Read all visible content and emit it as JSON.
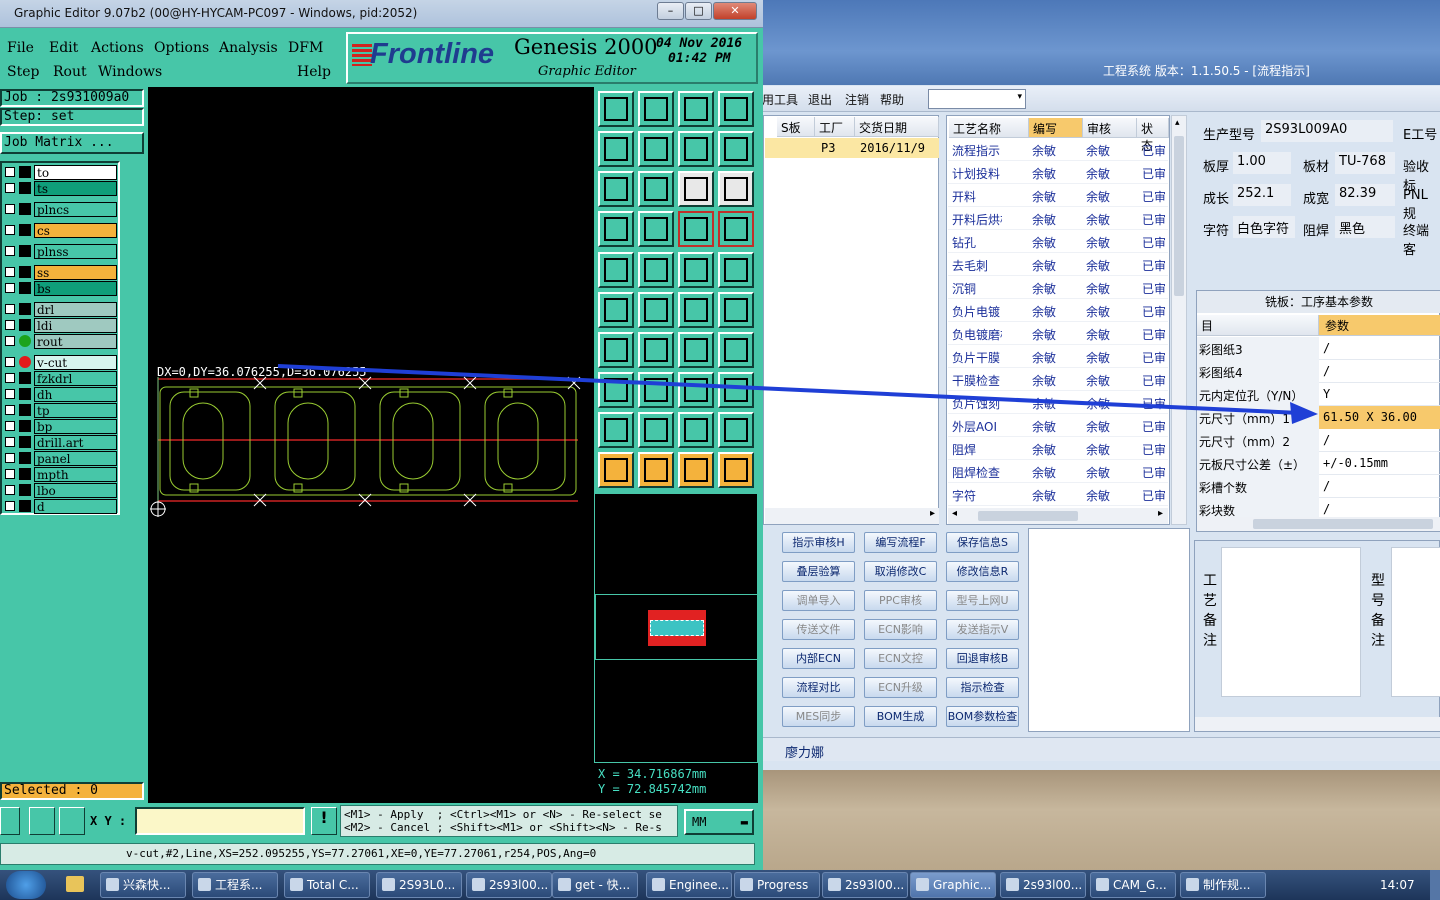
{
  "genesis": {
    "title": "Graphic Editor 9.07b2 (00@HY-HYCAM-PC097 - Windows, pid:2052)",
    "menu_row1": [
      "File",
      "Edit",
      "Actions",
      "Options",
      "Analysis",
      "DFM"
    ],
    "menu_row2": [
      "Step",
      "Rout",
      "Windows",
      "Help"
    ],
    "brand": "Frontline",
    "product": "Genesis 2000",
    "subtitle": "Graphic Editor",
    "date": "04 Nov 2016",
    "time": "01:42 PM",
    "job": "Job : 2s931009a0",
    "step": "Step: set",
    "job_matrix": "Job Matrix ...",
    "layers": [
      {
        "name": "to",
        "color": "#ffffff",
        "mark": "box"
      },
      {
        "name": "ts",
        "color": "#0f9e7a",
        "mark": "box"
      },
      {
        "name": "plncs",
        "color": "#47c6a8",
        "mark": "box"
      },
      {
        "name": "cs",
        "color": "#f4b23c",
        "mark": "box"
      },
      {
        "name": "plnss",
        "color": "#47c6a8",
        "mark": "box"
      },
      {
        "name": "ss",
        "color": "#f4b23c",
        "mark": "box"
      },
      {
        "name": "bs",
        "color": "#0f9e7a",
        "mark": "box"
      },
      {
        "name": "drl",
        "color": "#9fc9c0",
        "mark": "box"
      },
      {
        "name": "ldi",
        "color": "#9fc9c0",
        "mark": "box"
      },
      {
        "name": "rout",
        "color": "#9fc9c0",
        "mark": "green"
      },
      {
        "name": "v-cut",
        "color": "#d7f5ee",
        "mark": "red"
      },
      {
        "name": "fzkdrl",
        "color": "#47c6a8",
        "mark": "box"
      },
      {
        "name": "dh",
        "color": "#47c6a8",
        "mark": "box"
      },
      {
        "name": "tp",
        "color": "#47c6a8",
        "mark": "box"
      },
      {
        "name": "bp",
        "color": "#47c6a8",
        "mark": "box"
      },
      {
        "name": "drill.art",
        "color": "#47c6a8",
        "mark": "box"
      },
      {
        "name": "panel",
        "color": "#47c6a8",
        "mark": "box"
      },
      {
        "name": "mpth",
        "color": "#47c6a8",
        "mark": "box"
      },
      {
        "name": "lbo",
        "color": "#47c6a8",
        "mark": "box"
      },
      {
        "name": "d",
        "color": "#47c6a8",
        "mark": "box"
      }
    ],
    "selected": "Selected : 0",
    "measure": "DX=0,DY=36.076255,D=36.076255",
    "coord_x": "X = 34.716867mm",
    "coord_y": "Y = 72.845742mm",
    "xy_label": "X Y :",
    "hint1": "<M1> - Apply  ; <Ctrl><M1> or <N> - Re-select se",
    "hint2": "<M2> - Cancel ; <Shift><M1> or <Shift><N> - Re-s",
    "units": "MM",
    "status": "v-cut,#2,Line,XS=252.095255,YS=77.27061,XE=0,YE=77.27061,r254,POS,Ang=0"
  },
  "erp": {
    "title": "工程系统  版本：1.1.50.5 - [流程指示]",
    "menu": [
      "用工具",
      "退出",
      "注销",
      "帮助"
    ],
    "orders_headers": [
      "S板",
      "工厂",
      "交货日期"
    ],
    "orders_row": [
      "P3",
      "2016/11/9"
    ],
    "process_headers": [
      "工艺名称",
      "编写",
      "审核",
      "状态"
    ],
    "processes": [
      [
        "流程指示",
        "余敏",
        "余敏",
        "已审"
      ],
      [
        "计划投料",
        "余敏",
        "余敏",
        "已审"
      ],
      [
        "开料",
        "余敏",
        "余敏",
        "已审"
      ],
      [
        "开料后烘板",
        "余敏",
        "余敏",
        "已审"
      ],
      [
        "钻孔",
        "余敏",
        "余敏",
        "已审"
      ],
      [
        "去毛刺",
        "余敏",
        "余敏",
        "已审"
      ],
      [
        "沉铜",
        "余敏",
        "余敏",
        "已审"
      ],
      [
        "负片电镀",
        "余敏",
        "余敏",
        "已审"
      ],
      [
        "负电镀磨板",
        "余敏",
        "余敏",
        "已审"
      ],
      [
        "负片干膜",
        "余敏",
        "余敏",
        "已审"
      ],
      [
        "干膜检查",
        "余敏",
        "余敏",
        "已审"
      ],
      [
        "负片蚀刻",
        "余敏",
        "余敏",
        "已审"
      ],
      [
        "外层AOI",
        "余敏",
        "余敏",
        "已审"
      ],
      [
        "阻焊",
        "余敏",
        "余敏",
        "已审"
      ],
      [
        "阻焊检查",
        "余敏",
        "余敏",
        "已审"
      ],
      [
        "字符",
        "余敏",
        "余敏",
        "已审"
      ]
    ],
    "info": {
      "model_label": "生产型号",
      "model": "2S93L009A0",
      "eng_label": "E工号",
      "thick_label": "板厚",
      "thick": "1.00",
      "mat_label": "板材",
      "mat": "TU-768",
      "check_label": "验收标",
      "len_label": "成长",
      "len": "252.1",
      "wid_label": "成宽",
      "wid": "82.39",
      "pnl_label": "PNL规",
      "char_label": "字符",
      "char": "白色字符",
      "mask_label": "阻焊",
      "mask": "黑色",
      "term_label": "终端客"
    },
    "params_title": "铣板：工序基本参数",
    "params_header": [
      "目",
      "参数"
    ],
    "params": [
      [
        "彩图纸3",
        "/"
      ],
      [
        "彩图纸4",
        "/"
      ],
      [
        "元内定位孔（Y/N）",
        "Y"
      ],
      [
        "元尺寸（mm）1",
        "61.50 X 36.00"
      ],
      [
        "元尺寸（mm）2",
        "/"
      ],
      [
        "元板尺寸公差（±）",
        "+/-0.15mm"
      ],
      [
        "彩槽个数",
        "/"
      ],
      [
        "彩块数",
        "/"
      ]
    ],
    "buttons": [
      [
        "指示审核H",
        "编写流程F",
        "保存信息S"
      ],
      [
        "叠层验算",
        "取消修改C",
        "修改信息R"
      ],
      [
        "调单导入",
        "PPC审核",
        "型号上网U"
      ],
      [
        "传送文件",
        "ECN影响",
        "发送指示V"
      ],
      [
        "内部ECN",
        "ECN文控",
        "回退审核B"
      ],
      [
        "流程对比",
        "ECN升级",
        "指示检查"
      ],
      [
        "MES同步",
        "BOM生成",
        "BOM参数检查"
      ]
    ],
    "disabled": [
      "调单导入",
      "PPC审核",
      "型号上网U",
      "传送文件",
      "ECN影响",
      "发送指示V",
      "ECN文控",
      "ECN升级",
      "MES同步"
    ],
    "note_left": [
      "工",
      "艺",
      "备",
      "注"
    ],
    "note_right": [
      "型",
      "号",
      "备",
      "注"
    ],
    "user": "廖力娜"
  },
  "taskbar": {
    "items": [
      "兴森快...",
      "工程系...",
      "Total C...",
      "2S93L0...",
      "2s93l00...",
      "get - 快...",
      "Enginee...",
      "Progress",
      "2s93l00...",
      "Graphic...",
      "2s93l00...",
      "CAM_G...",
      "制作规..."
    ],
    "clock": "14:07"
  }
}
